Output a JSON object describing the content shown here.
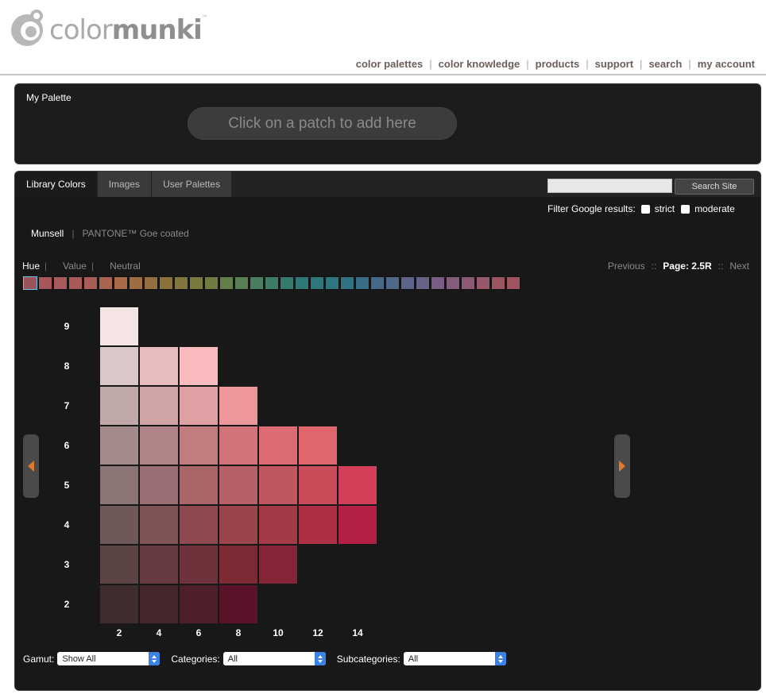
{
  "logo": {
    "text_light": "color",
    "text_bold": "munki",
    "tm": "™"
  },
  "topnav": [
    "color palettes",
    "color knowledge",
    "products",
    "support",
    "search",
    "my account"
  ],
  "my_palette": {
    "title": "My Palette",
    "placeholder": "Click on a patch to add here"
  },
  "tabs": [
    {
      "label": "Library Colors",
      "active": true
    },
    {
      "label": "Images",
      "active": false
    },
    {
      "label": "User Palettes",
      "active": false
    }
  ],
  "search": {
    "value": "",
    "button_label": "Search Site"
  },
  "filter": {
    "label": "Filter Google results:",
    "strict_label": "strict",
    "moderate_label": "moderate"
  },
  "libraries": {
    "active": "Munsell",
    "other": "PANTONE™ Goe coated",
    "sep": "|"
  },
  "modes": {
    "hue": "Hue",
    "value": "Value",
    "neutral": "Neutral",
    "sep": "|"
  },
  "pager": {
    "previous": "Previous",
    "page": "Page: 2.5R",
    "next": "Next",
    "sep": "::"
  },
  "hue_strip": [
    "#9a5458",
    "#a8565c",
    "#a85a5c",
    "#a85a58",
    "#a85e56",
    "#a86450",
    "#a86a48",
    "#9c6e40",
    "#946e3e",
    "#8a723c",
    "#80763e",
    "#787a40",
    "#6e7c44",
    "#647e4a",
    "#5a7e54",
    "#4a7e60",
    "#3e7c68",
    "#367a70",
    "#307876",
    "#2e787c",
    "#30767e",
    "#327282",
    "#3a6e86",
    "#446a88",
    "#52688a",
    "#5e6488",
    "#6a6286",
    "#785e82",
    "#845c7c",
    "#8c5a74",
    "#96586a",
    "#9c5660",
    "#a05460"
  ],
  "chart_data": {
    "type": "heatmap",
    "title": "",
    "xlabel": "",
    "ylabel": "",
    "x": [
      2,
      4,
      6,
      8,
      10,
      12,
      14
    ],
    "y": [
      9,
      8,
      7,
      6,
      5,
      4,
      3,
      2
    ],
    "x_tick_labels": [
      "2",
      "4",
      "6",
      "8",
      "10",
      "12",
      "14"
    ],
    "y_tick_labels": [
      "9",
      "8",
      "7",
      "6",
      "5",
      "4",
      "3",
      "2"
    ],
    "cells": [
      [
        "#f5e4e4",
        null,
        null,
        null,
        null,
        null,
        null
      ],
      [
        "#dac7c7",
        "#e8bcbe",
        "#fbbbbe",
        null,
        null,
        null,
        null
      ],
      [
        "#bfa8a8",
        "#cfa5a6",
        "#dea0a2",
        "#ec9799",
        null,
        null,
        null
      ],
      [
        "#a48b8b",
        "#b08486",
        "#c27c80",
        "#d17479",
        "#dc6c73",
        "#e0666e",
        null
      ],
      [
        "#8b7575",
        "#9a6e72",
        "#a96669",
        "#b6606a",
        "#c0565f",
        "#c94c5a",
        "#d43e58"
      ],
      [
        "#6e5858",
        "#805457",
        "#8d494f",
        "#9a444c",
        "#a23a47",
        "#ad2f44",
        "#b41f45"
      ],
      [
        "#5b4444",
        "#683b43",
        "#70323a",
        "#7d2a35",
        "#842638",
        null,
        null
      ],
      [
        "#3e2c2e",
        "#45262c",
        "#4e1f29",
        "#5a1429",
        null,
        null,
        null
      ]
    ]
  },
  "bottom": {
    "gamut_label": "Gamut:",
    "gamut_value": "Show All",
    "categories_label": "Categories:",
    "categories_value": "All",
    "subcategories_label": "Subcategories:",
    "subcategories_value": "All"
  }
}
